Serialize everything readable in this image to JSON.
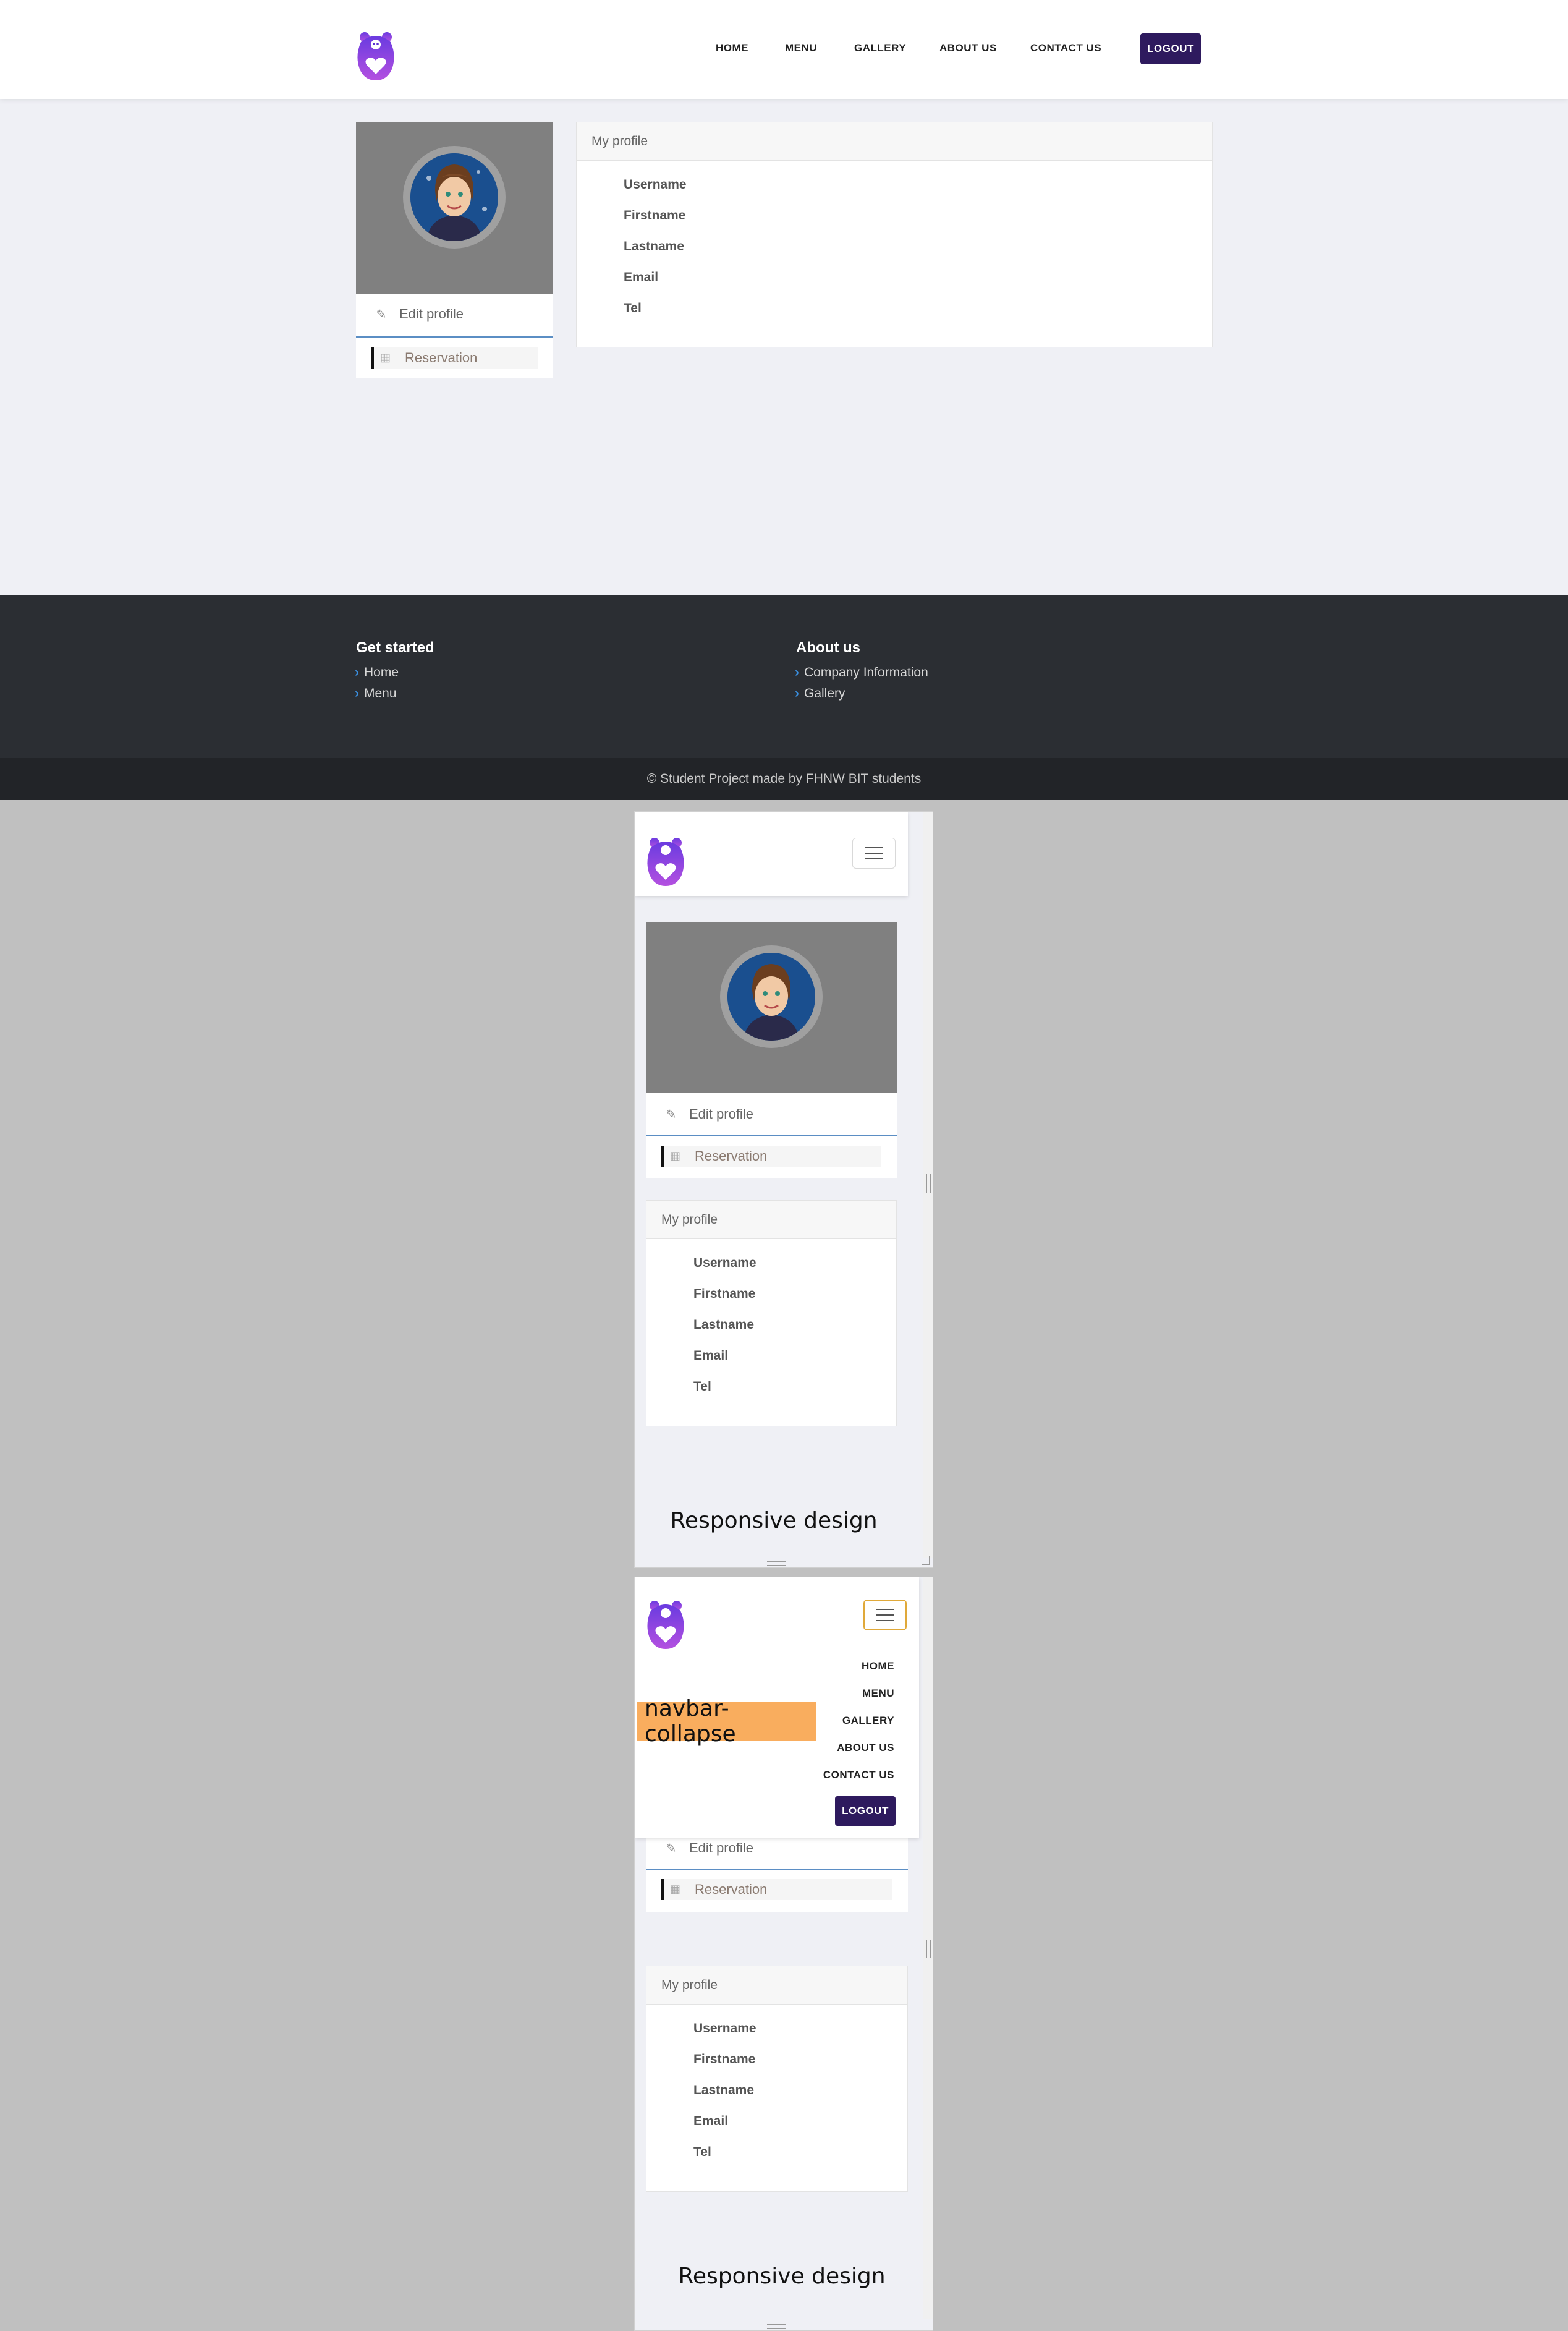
{
  "nav": {
    "links": [
      "HOME",
      "MENU",
      "GALLERY",
      "ABOUT US",
      "CONTACT US"
    ],
    "logout_label": "LOGOUT"
  },
  "sidebar": {
    "edit_profile": "Edit profile",
    "reservation": "Reservation"
  },
  "profile": {
    "title": "My profile",
    "fields": [
      "Username",
      "Firstname",
      "Lastname",
      "Email",
      "Tel"
    ]
  },
  "footer": {
    "col1_title": "Get started",
    "col1_links": [
      "Home",
      "Menu"
    ],
    "col2_title": "About us",
    "col2_links": [
      "Company Information",
      "Gallery"
    ],
    "copyright": "© Student Project made by FHNW BIT students"
  },
  "mobile": {
    "caption": "Responsive design",
    "collapse_label": "navbar-collapse"
  },
  "colors": {
    "accent": "#2e1a5e",
    "logo": "#7b3fe4",
    "footer": "#2b2e33",
    "highlight": "#f9ad5e"
  }
}
